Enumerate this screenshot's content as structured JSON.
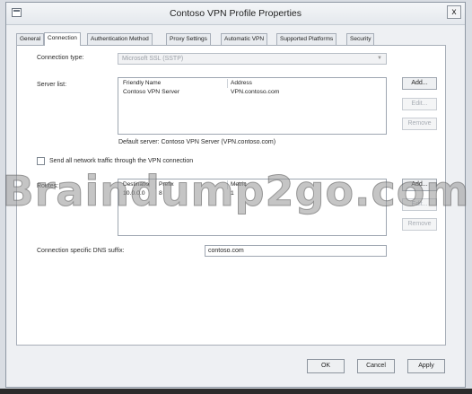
{
  "window": {
    "title": "Contoso VPN Profile Properties",
    "close_label": "x"
  },
  "tabs": [
    {
      "label": "General"
    },
    {
      "label": "Connection"
    },
    {
      "label": "Authentication Method"
    },
    {
      "label": "Proxy Settings"
    },
    {
      "label": "Automatic VPN"
    },
    {
      "label": "Supported Platforms"
    },
    {
      "label": "Security"
    }
  ],
  "connection": {
    "type_label": "Connection type:",
    "type_value": "Microsoft SSL (SSTP)",
    "server_list_label": "Server list:",
    "server_columns": [
      "Friendly Name",
      "Address"
    ],
    "server_rows": [
      [
        "Contoso VPN Server",
        "VPN.contoso.com"
      ]
    ],
    "server_buttons": {
      "add": "Add...",
      "edit": "Edit...",
      "remove": "Remove"
    },
    "default_server": "Default server: Contoso VPN Server (VPN.contoso.com)",
    "send_all_label": "Send all network traffic through the VPN connection",
    "routes_label": "Routes:",
    "route_columns": [
      "Destinatio",
      "Prefix",
      "Metric"
    ],
    "route_rows": [
      [
        "10.0.0.0",
        "8",
        "1"
      ]
    ],
    "route_buttons": {
      "add": "Add...",
      "edit": "Edit...",
      "remove": "Remove"
    },
    "dns_label": "Connection specific DNS suffix:",
    "dns_value": "contoso.com"
  },
  "footer": {
    "ok": "OK",
    "cancel": "Cancel",
    "apply": "Apply"
  },
  "watermark": "Braindump2go.com"
}
